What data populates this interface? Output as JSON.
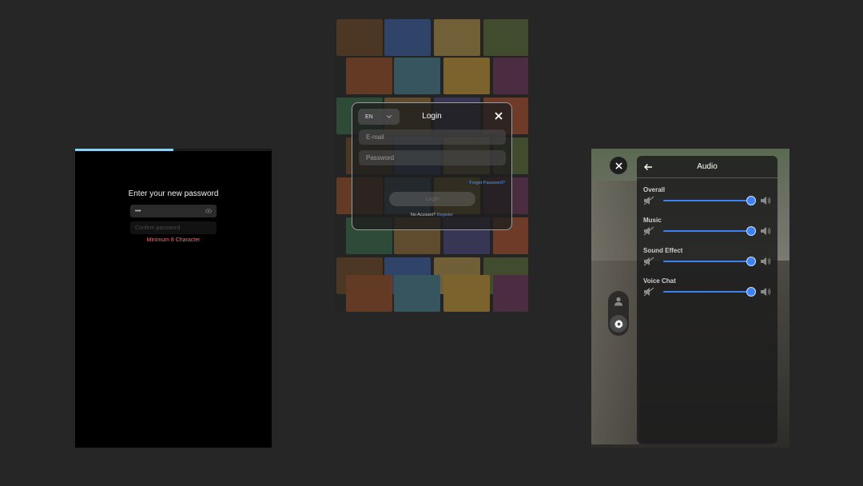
{
  "reset_password": {
    "progress": 0.5,
    "title": "Enter your new password",
    "password_value": "•••",
    "confirm_placeholder": "Confirm password",
    "error": "Minimum 8 Character"
  },
  "login": {
    "language": "EN",
    "title": "Login",
    "email_placeholder": "E-mail",
    "password_placeholder": "Password",
    "forgot_password": "Forgot Password?",
    "login_button": "Login",
    "no_account": "No Account?",
    "register": "Register"
  },
  "audio": {
    "title": "Audio",
    "accent_color": "#3b82f6",
    "channels": [
      {
        "label": "Overall",
        "level": 1.0
      },
      {
        "label": "Music",
        "level": 1.0
      },
      {
        "label": "Sound Effect",
        "level": 1.0
      },
      {
        "label": "Voice Chat",
        "level": 1.0
      }
    ],
    "icons": [
      "close-icon",
      "back-arrow-icon",
      "user-icon",
      "gear-icon",
      "mute-icon",
      "speaker-icon"
    ]
  }
}
